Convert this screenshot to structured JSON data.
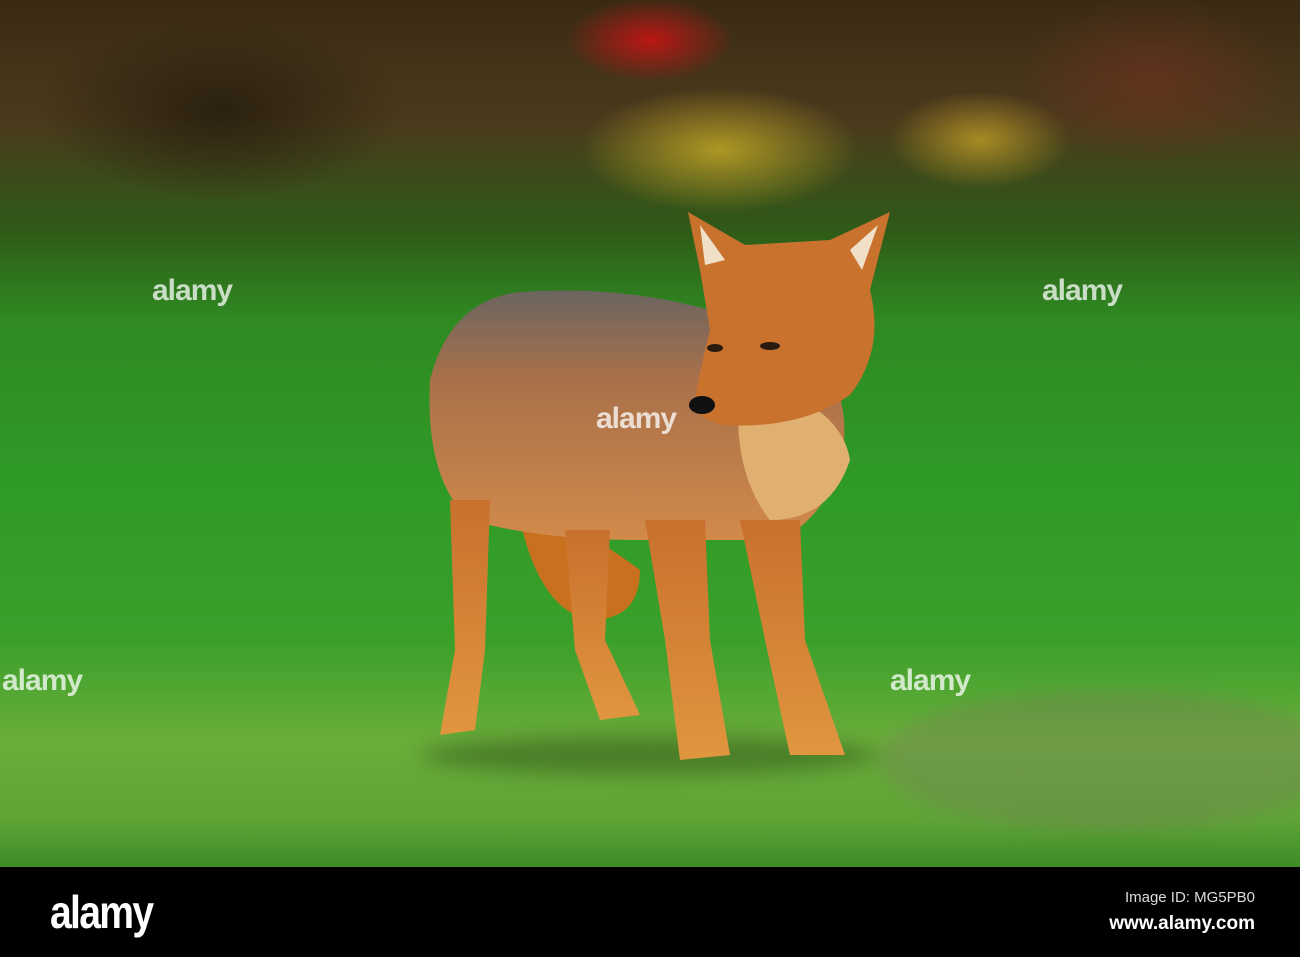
{
  "watermark": {
    "text": "alamy"
  },
  "footer": {
    "logo": "alamy",
    "image_id": "Image ID: MG5PB0",
    "website": "www.alamy.com"
  }
}
